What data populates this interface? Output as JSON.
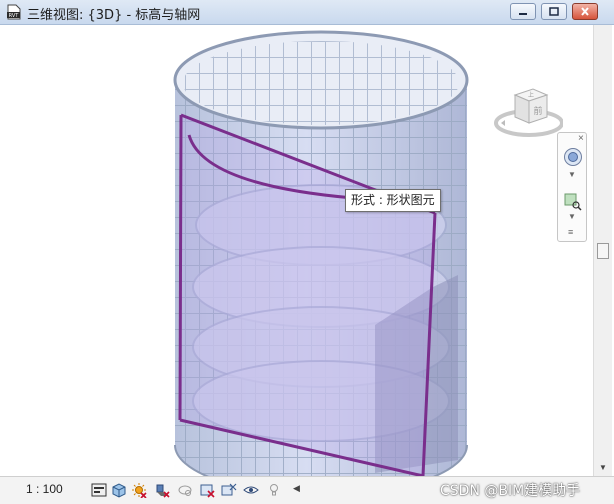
{
  "window": {
    "app_icon_text": "RVT",
    "title": "三维视图: {3D} - 标高与轴网"
  },
  "viewport": {
    "tooltip": "形式 : 形状图元"
  },
  "viewcube": {
    "face_label": "前",
    "side_label": "上"
  },
  "statusbar": {
    "scale": "1 : 100",
    "watermark": "CSDN @BIM建模助手"
  },
  "colors": {
    "glass": "#c8d3ee",
    "mullion": "#9aa9c4",
    "selection": "#7a2e8c",
    "titlebar": "#d6e3f3"
  }
}
